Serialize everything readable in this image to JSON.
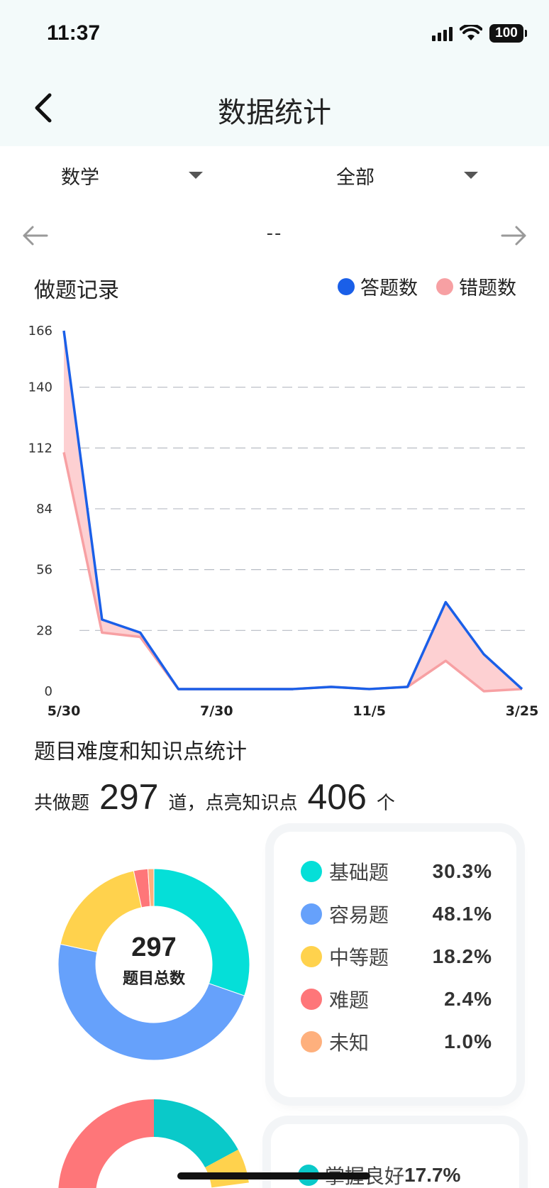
{
  "status": {
    "time": "11:37",
    "battery": "100"
  },
  "nav": {
    "title": "数据统计"
  },
  "filters": {
    "subject": "数学",
    "scope": "全部"
  },
  "period": {
    "text": "--"
  },
  "record": {
    "title": "做题记录",
    "legend": [
      {
        "label": "答题数",
        "color": "#1a5fe8"
      },
      {
        "label": "错题数",
        "color": "#f7a0a3"
      }
    ]
  },
  "chart_data": {
    "type": "area",
    "title": "做题记录",
    "xlabel": "",
    "ylabel": "",
    "ylim": [
      0,
      166
    ],
    "yticks": [
      0,
      28,
      56,
      84,
      112,
      140,
      166
    ],
    "x_tick_labels": [
      "5/30",
      "7/30",
      "11/5",
      "3/25"
    ],
    "grid": true,
    "legend_position": "top-right",
    "series": [
      {
        "name": "答题数",
        "color": "#1a5fe8",
        "values": [
          166,
          33,
          27,
          1,
          1,
          1,
          1,
          2,
          1,
          2,
          41,
          17,
          1
        ]
      },
      {
        "name": "错题数",
        "color": "#f7a0a3",
        "values": [
          110,
          27,
          25,
          1,
          1,
          1,
          1,
          2,
          1,
          2,
          14,
          0,
          1
        ]
      }
    ]
  },
  "difficulty": {
    "title": "题目难度和知识点统计",
    "summary_prefix": "共做题",
    "total_questions": "297",
    "summary_mid": "道，点亮知识点",
    "total_points": "406",
    "summary_suffix": "个",
    "donut_total": "297",
    "donut_caption": "题目总数",
    "items": [
      {
        "name": "基础题",
        "pct": "30.3%",
        "value": 30.3,
        "color": "#05dfd8"
      },
      {
        "name": "容易题",
        "pct": "48.1%",
        "value": 48.1,
        "color": "#66a1fb"
      },
      {
        "name": "中等题",
        "pct": "18.2%",
        "value": 18.2,
        "color": "#ffd24d"
      },
      {
        "name": "难题",
        "pct": "2.4%",
        "value": 2.4,
        "color": "#fe7679"
      },
      {
        "name": "未知",
        "pct": "1.0%",
        "value": 1.0,
        "color": "#feb07d"
      }
    ]
  },
  "mastery": {
    "first_item": {
      "name": "掌握良好",
      "pct": "17.7%",
      "value": 17.7,
      "color": "#0ac9c9"
    },
    "partial_slices": [
      {
        "color": "#0ac9c9",
        "value": 17.7
      },
      {
        "color": "#ffd24d",
        "value": 6
      },
      {
        "color": "#fe7679",
        "value": 28
      }
    ]
  }
}
